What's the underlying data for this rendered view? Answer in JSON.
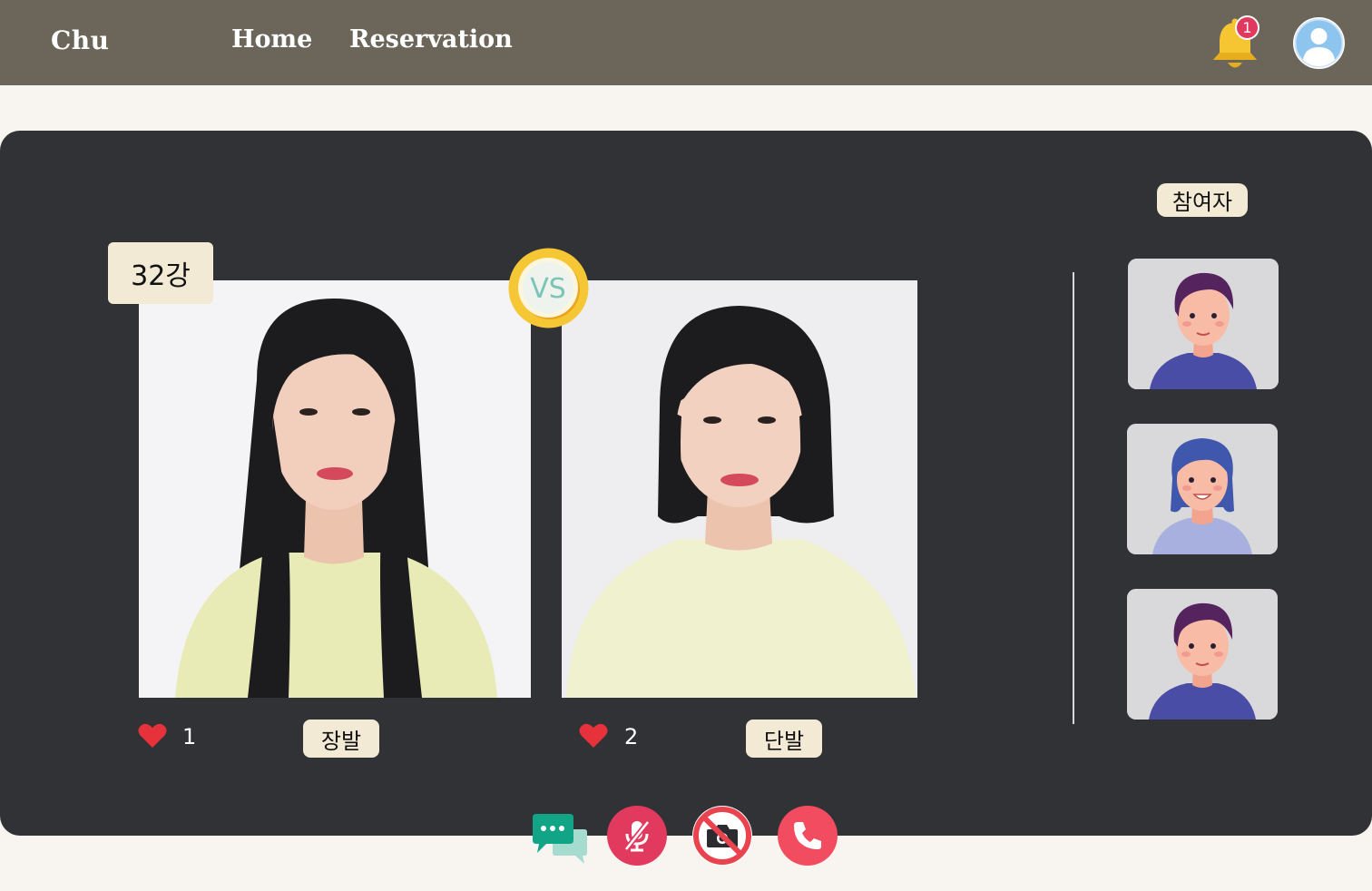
{
  "nav": {
    "brand": "Chu",
    "links": [
      "Home",
      "Reservation"
    ],
    "notification_count": "1",
    "icons": {
      "notification": "bell-icon",
      "profile": "user-avatar-icon"
    }
  },
  "match": {
    "round_label": "32강",
    "vs_label": "VS",
    "left": {
      "tag": "장발",
      "likes": "1",
      "photo": "long-hair-woman-photo"
    },
    "right": {
      "tag": "단발",
      "likes": "2",
      "photo": "short-hair-woman-photo"
    }
  },
  "participants": {
    "label": "참여자",
    "items": [
      "male-avatar",
      "female-avatar",
      "male-avatar"
    ]
  },
  "controls": {
    "icons": [
      "chat-icon",
      "mic-off-icon",
      "camera-off-icon",
      "hang-up-icon"
    ]
  },
  "colors": {
    "header": "#6c665a",
    "panel": "#313236",
    "tag_bg": "#f3ead6",
    "heart": "#e8323b",
    "chat": "#11a487",
    "mic": "#e23a5e",
    "camera_ring": "#e9434f",
    "hangup": "#f14c5f",
    "bell": "#f6c632"
  }
}
